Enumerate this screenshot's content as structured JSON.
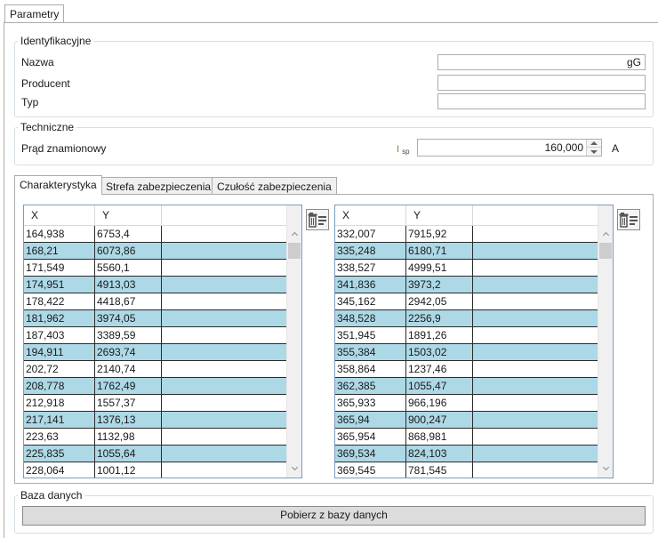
{
  "main_tab": {
    "label": "Parametry"
  },
  "identification": {
    "title": "Identyfikacyjne",
    "name_label": "Nazwa",
    "name_value": "gG",
    "producer_label": "Producent",
    "producer_value": "",
    "type_label": "Typ",
    "type_value": ""
  },
  "technical": {
    "title": "Techniczne",
    "rated_current_label": "Prąd znamionowy",
    "isp_symbol": "I",
    "isp_subscript": "sp",
    "rated_current_value": "160,000",
    "unit": "A"
  },
  "subtabs": [
    {
      "label": "Charakterystyka",
      "active": true
    },
    {
      "label": "Strefa zabezpieczenia",
      "active": false
    },
    {
      "label": "Czułość zabezpieczenia",
      "active": false
    }
  ],
  "tables": [
    {
      "headers": [
        "X",
        "Y"
      ],
      "rows": [
        [
          "164,938",
          "6753,4"
        ],
        [
          "168,21",
          "6073,86"
        ],
        [
          "171,549",
          "5560,1"
        ],
        [
          "174,951",
          "4913,03"
        ],
        [
          "178,422",
          "4418,67"
        ],
        [
          "181,962",
          "3974,05"
        ],
        [
          "187,403",
          "3389,59"
        ],
        [
          "194,911",
          "2693,74"
        ],
        [
          "202,72",
          "2140,74"
        ],
        [
          "208,778",
          "1762,49"
        ],
        [
          "212,918",
          "1557,37"
        ],
        [
          "217,141",
          "1376,13"
        ],
        [
          "223,63",
          "1132,98"
        ],
        [
          "225,835",
          "1055,64"
        ],
        [
          "228,064",
          "1001,12"
        ]
      ]
    },
    {
      "headers": [
        "X",
        "Y"
      ],
      "rows": [
        [
          "332,007",
          "7915,92"
        ],
        [
          "335,248",
          "6180,71"
        ],
        [
          "338,527",
          "4999,51"
        ],
        [
          "341,836",
          "3973,2"
        ],
        [
          "345,162",
          "2942,05"
        ],
        [
          "348,528",
          "2256,9"
        ],
        [
          "351,945",
          "1891,26"
        ],
        [
          "355,384",
          "1503,02"
        ],
        [
          "358,864",
          "1237,46"
        ],
        [
          "362,385",
          "1055,47"
        ],
        [
          "365,933",
          "966,196"
        ],
        [
          "365,94",
          "900,247"
        ],
        [
          "365,954",
          "868,981"
        ],
        [
          "369,534",
          "824,103"
        ],
        [
          "369,545",
          "781,545"
        ]
      ]
    }
  ],
  "database": {
    "title": "Baza danych",
    "fetch_button": "Pobierz z bazy danych"
  },
  "icons": {
    "delete_rows": "delete-rows-icon",
    "scroll_up": "chevron-up-icon",
    "scroll_down": "chevron-down-icon",
    "spin_up": "triangle-up-icon",
    "spin_down": "triangle-down-icon"
  },
  "colors": {
    "alt_row": "#add8e6",
    "grid_border": "#7a9cc0",
    "isp_symbol": "#5a9a3a"
  }
}
